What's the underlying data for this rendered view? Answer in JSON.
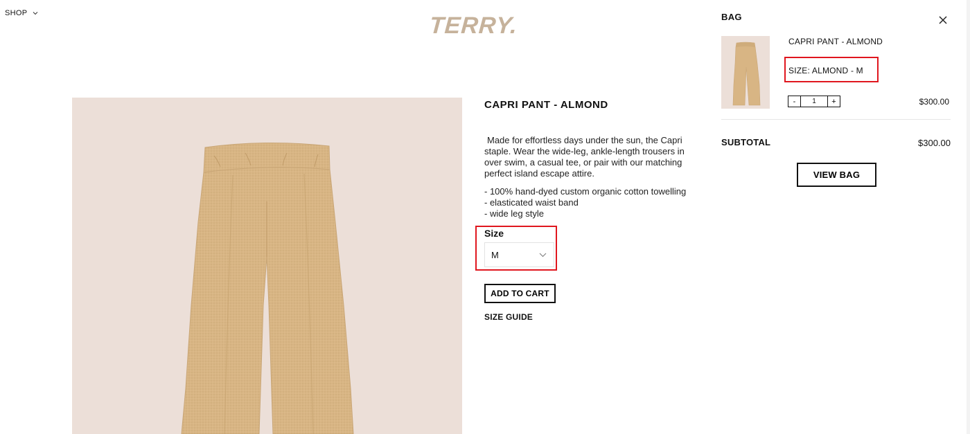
{
  "header": {
    "shop_label": "SHOP",
    "logo_text": "TERRY."
  },
  "product": {
    "title": "CAPRI PANT - ALMOND",
    "description_lines": [
      "Made for effortless days under the sun, the Capri",
      "staple. Wear the wide-leg, ankle-length trousers in",
      "over swim, a casual tee, or pair with our matching",
      "perfect island escape attire."
    ],
    "features": [
      "- 100% hand-dyed custom organic cotton towelling",
      "- elasticated waist band",
      "- wide leg style"
    ],
    "size_label": "Size",
    "size_value": "M",
    "add_to_cart_label": "ADD TO CART",
    "size_guide_label": "SIZE GUIDE",
    "image_bg": "#ecdfd8",
    "pant_color": "#d8b584"
  },
  "bag": {
    "title": "BAG",
    "item": {
      "name": "CAPRI PANT - ALMOND",
      "variant": "SIZE: ALMOND - M",
      "qty_minus": "-",
      "qty_value": "1",
      "qty_plus": "+",
      "price": "$300.00"
    },
    "subtotal_label": "SUBTOTAL",
    "subtotal_value": "$300.00",
    "view_bag_label": "VIEW BAG"
  },
  "colors": {
    "logo": "#c6b29b",
    "highlight": "#e0161e"
  }
}
